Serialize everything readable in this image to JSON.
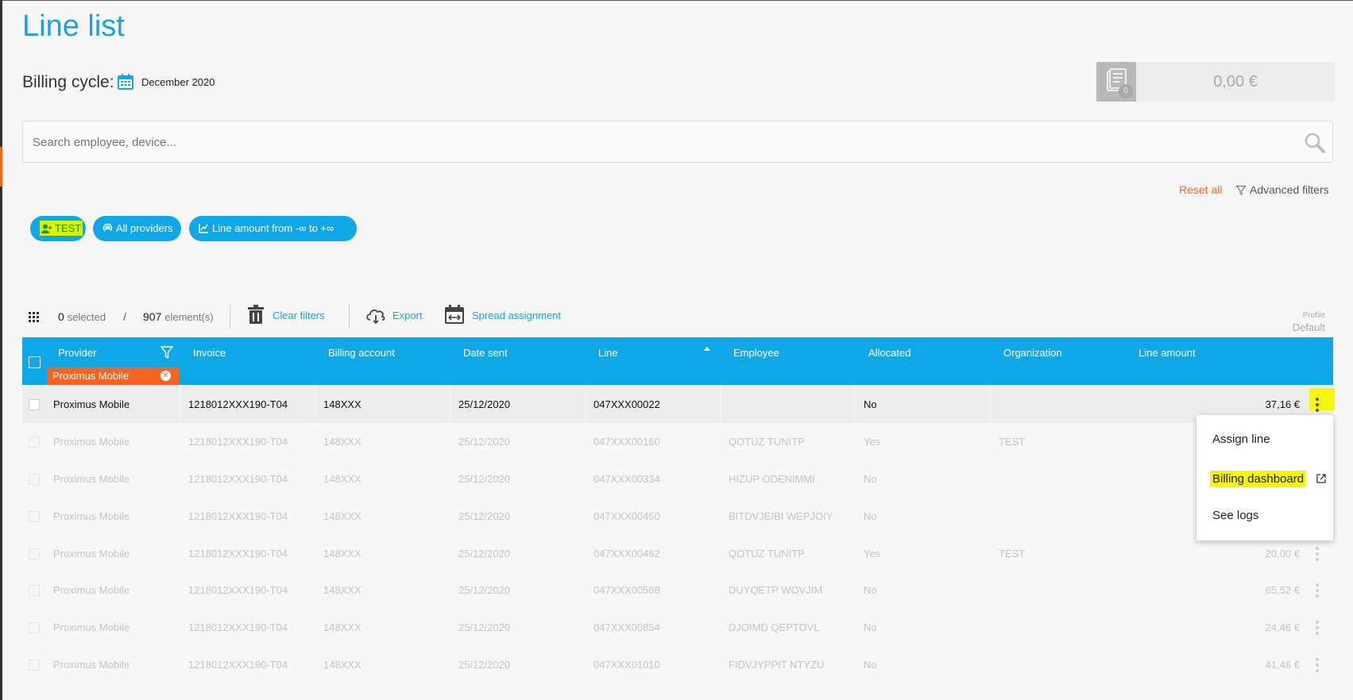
{
  "page": {
    "title": "Line list",
    "billing_cycle_label": "Billing cycle:",
    "billing_cycle_value": "December 2020",
    "total_amount": "0,00 €",
    "invoice_badge": "0"
  },
  "search": {
    "placeholder": "Search employee, device..."
  },
  "filters": {
    "reset_all": "Reset all",
    "advanced": "Advanced filters",
    "chips": [
      "TEST",
      "All providers",
      "Line amount from -∞ to +∞"
    ]
  },
  "toolbar": {
    "selected_count": "0",
    "selected_label": "selected",
    "slash": "/",
    "element_count": "907",
    "element_label": "element(s)",
    "clear_filters": "Clear filters",
    "export": "Export",
    "spread_assignment": "Spread assignment",
    "profile_label": "Profile",
    "profile_value": "Default"
  },
  "table": {
    "columns": [
      "Provider",
      "Invoice",
      "Billing account",
      "Date sent",
      "Line",
      "Employee",
      "Allocated",
      "Organization",
      "Line amount"
    ],
    "provider_filter_tag": "Proximus Mobile",
    "rows": [
      {
        "provider": "Proximus Mobile",
        "invoice": "1218012XXX190-T04",
        "billing_account": "148XXX",
        "date_sent": "25/12/2020",
        "line": "047XXX00022",
        "employee": "",
        "allocated": "No",
        "organization": "",
        "amount": "37,16 €"
      },
      {
        "provider": "Proximus Mobile",
        "invoice": "1218012XXX190-T04",
        "billing_account": "148XXX",
        "date_sent": "25/12/2020",
        "line": "047XXX00160",
        "employee": "QOTUZ TUNITP",
        "allocated": "Yes",
        "organization": "TEST",
        "amount": ""
      },
      {
        "provider": "Proximus Mobile",
        "invoice": "1218012XXX190-T04",
        "billing_account": "148XXX",
        "date_sent": "25/12/2020",
        "line": "047XXX00334",
        "employee": "HIZUP ODENIMMI",
        "allocated": "No",
        "organization": "",
        "amount": ""
      },
      {
        "provider": "Proximus Mobile",
        "invoice": "1218012XXX190-T04",
        "billing_account": "148XXX",
        "date_sent": "25/12/2020",
        "line": "047XXX00460",
        "employee": "BITDVJEIBI WEPJOIY",
        "allocated": "No",
        "organization": "",
        "amount": ""
      },
      {
        "provider": "Proximus Mobile",
        "invoice": "1218012XXX190-T04",
        "billing_account": "148XXX",
        "date_sent": "25/12/2020",
        "line": "047XXX00462",
        "employee": "QOTUZ TUNITP",
        "allocated": "Yes",
        "organization": "TEST",
        "amount": "20,00 €"
      },
      {
        "provider": "Proximus Mobile",
        "invoice": "1218012XXX190-T04",
        "billing_account": "148XXX",
        "date_sent": "25/12/2020",
        "line": "047XXX00568",
        "employee": "DUYQETP WOVJIM",
        "allocated": "No",
        "organization": "",
        "amount": "65,52 €"
      },
      {
        "provider": "Proximus Mobile",
        "invoice": "1218012XXX190-T04",
        "billing_account": "148XXX",
        "date_sent": "25/12/2020",
        "line": "047XXX00854",
        "employee": "DJOIMD QEPTOVL",
        "allocated": "No",
        "organization": "",
        "amount": "24,46 €"
      },
      {
        "provider": "Proximus Mobile",
        "invoice": "1218012XXX190-T04",
        "billing_account": "148XXX",
        "date_sent": "25/12/2020",
        "line": "047XXX01010",
        "employee": "FIDVJYPPIT NTYZU",
        "allocated": "No",
        "organization": "",
        "amount": "41,46 €"
      }
    ]
  },
  "context_menu": {
    "items": [
      "Assign line",
      "Billing dashboard",
      "See logs"
    ]
  },
  "colors": {
    "accent": "#1aa2e0",
    "header_blue": "#0fa7e6",
    "orange": "#f26522",
    "highlight": "#f5f511"
  },
  "icons": [
    "calendar-icon",
    "invoice-stack-icon",
    "search-icon",
    "funnel-icon",
    "user-icon",
    "signal-icon",
    "chart-icon",
    "grid-icon",
    "trash-icon",
    "cloud-download-icon",
    "spread-calendar-icon",
    "kebab-menu-icon",
    "external-link-icon"
  ]
}
